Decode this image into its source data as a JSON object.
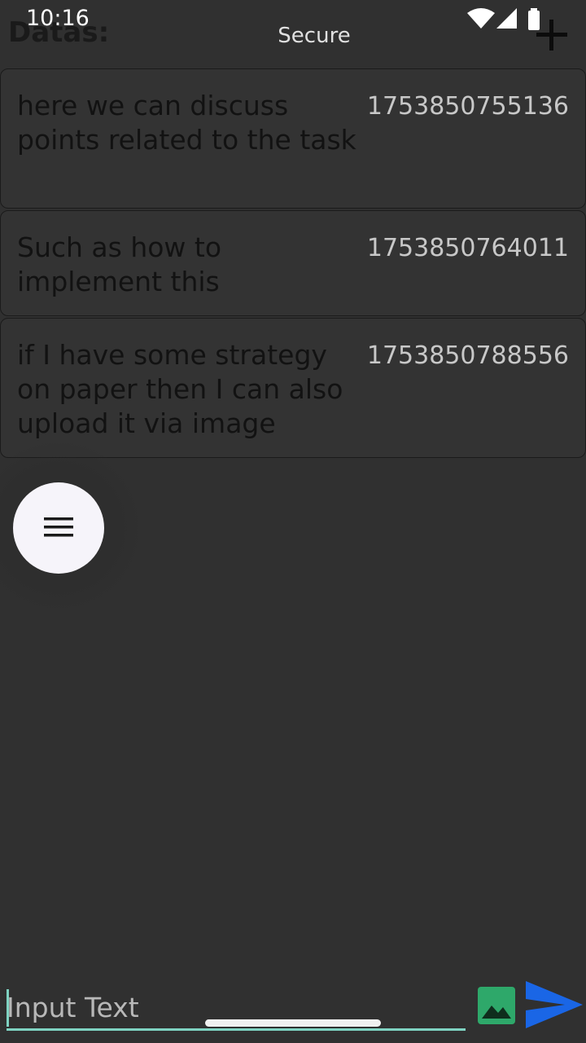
{
  "status_bar": {
    "time": "10:16"
  },
  "header": {
    "title": "Datas:",
    "subtitle": "Secure"
  },
  "cards": [
    {
      "text": "here we can discuss points related to the task",
      "timestamp": "1753850755136"
    },
    {
      "text": "Such as how to implement this",
      "timestamp": "1753850764011"
    },
    {
      "text": "if I have some strategy on paper then I can also upload it via image",
      "timestamp": "1753850788556"
    }
  ],
  "composer": {
    "placeholder": "Input Text"
  },
  "colors": {
    "background": "#303030",
    "accent": "#7fd3c2",
    "send": "#1a66e6",
    "image": "#2ea86a"
  }
}
